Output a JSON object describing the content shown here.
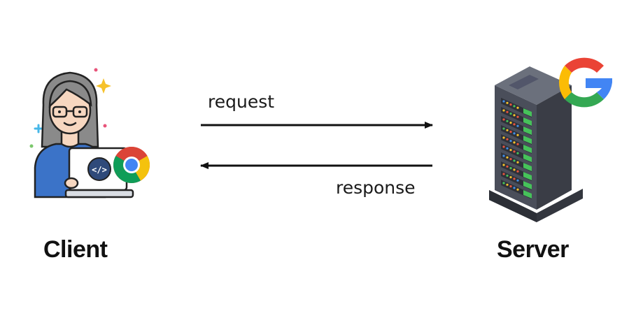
{
  "diagram": {
    "client_label": "Client",
    "server_label": "Server",
    "request_label": "request",
    "response_label": "response"
  },
  "icons": {
    "client": "woman-with-laptop-icon",
    "browser": "chrome-icon",
    "server": "server-rack-icon",
    "google": "google-g-icon"
  },
  "colors": {
    "arrow": "#111111",
    "shirt": "#3b73c8",
    "hair": "#8a8a8a",
    "server_body": "#4a4e5a",
    "server_top": "#5f6470",
    "led_green": "#46c25a",
    "led_red": "#e8543f",
    "led_yellow": "#f6c22b",
    "led_blue": "#3f8ee8"
  }
}
